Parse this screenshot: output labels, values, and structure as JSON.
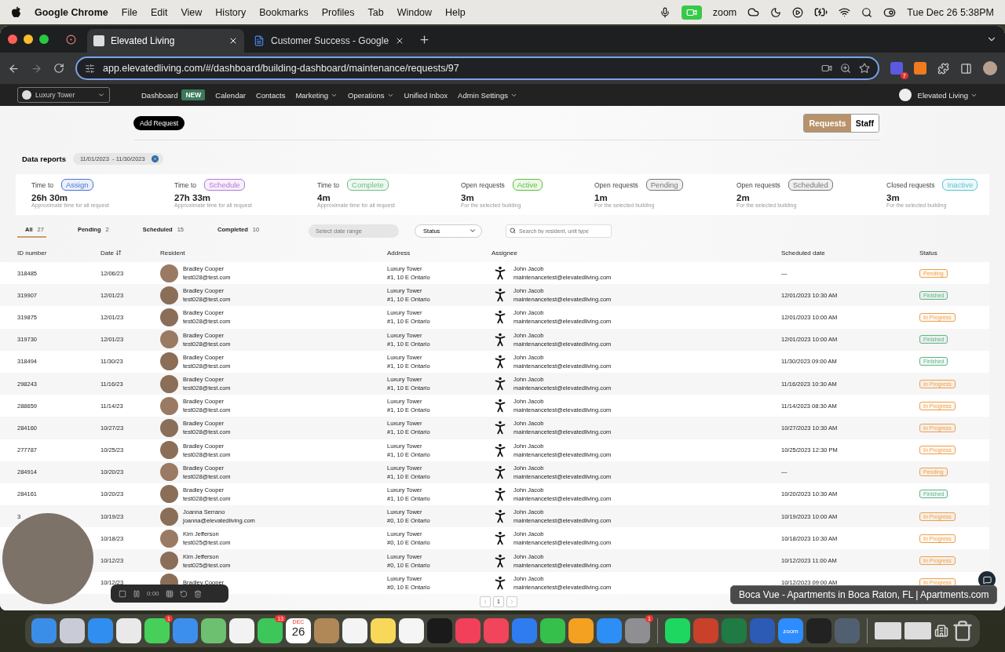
{
  "menubar": {
    "app": "Google Chrome",
    "menus": [
      "File",
      "Edit",
      "View",
      "History",
      "Bookmarks",
      "Profiles",
      "Tab",
      "Window",
      "Help"
    ],
    "zoom_label": "zoom",
    "clock": "Tue Dec 26  5:38PM"
  },
  "browser": {
    "tabs": [
      {
        "title": "Elevated Living",
        "selected": true
      },
      {
        "title": "Customer Success - Google",
        "selected": false
      }
    ],
    "url": "app.elevatedliving.com/#/dashboard/building-dashboard/maintenance/requests/97",
    "extension_badge": "7"
  },
  "nav": {
    "building": "Luxury Tower",
    "items": [
      {
        "label": "Dashboard",
        "badge": "NEW",
        "dropdown": false
      },
      {
        "label": "Calendar",
        "dropdown": false
      },
      {
        "label": "Contacts",
        "dropdown": false
      },
      {
        "label": "Marketing",
        "dropdown": true
      },
      {
        "label": "Operations",
        "dropdown": true
      },
      {
        "label": "Unified Inbox",
        "dropdown": false
      },
      {
        "label": "Admin Settings",
        "dropdown": true
      }
    ],
    "user": "Elevated Living"
  },
  "add_request": "Add Request",
  "view_toggle": [
    {
      "label": "Requests",
      "selected": true
    },
    {
      "label": "Staff",
      "selected": false
    }
  ],
  "reports": {
    "label": "Data reports",
    "date_range": "11/01/2023  - 11/30/2023"
  },
  "stats": [
    {
      "label": "Time to",
      "tag": "Assign",
      "color": "#4a72d6",
      "value": "26h 30m",
      "note": "Approximate time for all request"
    },
    {
      "label": "Time to",
      "tag": "Schedule",
      "color": "#b47ad8",
      "value": "27h 33m",
      "note": "Approximate time for all request"
    },
    {
      "label": "Time to",
      "tag": "Complete",
      "color": "#6cbf86",
      "value": "4m",
      "note": "Approximate time for all request"
    },
    {
      "label": "Open requests",
      "tag": "Active",
      "color": "#5cbf3c",
      "value": "3m",
      "note": "For the selected building"
    },
    {
      "label": "Open requests",
      "tag": "Pending",
      "color": "#777777",
      "value": "1m",
      "note": "For the selected building"
    },
    {
      "label": "Open requests",
      "tag": "Scheduled",
      "color": "#777777",
      "value": "2m",
      "note": "For the selected building"
    },
    {
      "label": "Closed requests",
      "tag": "Inactive",
      "color": "#5ec4d4",
      "value": "3m",
      "note": "For the selected building"
    }
  ],
  "filter_tabs": [
    {
      "label": "All",
      "count": "27",
      "selected": true
    },
    {
      "label": "Pending",
      "count": "2",
      "selected": false
    },
    {
      "label": "Scheduled",
      "count": "15",
      "selected": false
    },
    {
      "label": "Completed",
      "count": "10",
      "selected": false
    }
  ],
  "date_range": {
    "placeholder": "Select date range"
  },
  "status_filter": "Status",
  "search": {
    "placeholder": "Search by resident, unit type"
  },
  "table": {
    "columns": [
      "ID number",
      "Date",
      "Resident",
      "Address",
      "Assignee",
      "Scheduled date",
      "Status"
    ],
    "rows": [
      {
        "id": "318485",
        "date": "12/06/23",
        "resident": "Bradley Cooper",
        "email": "test028@test.com",
        "building": "Luxury Tower",
        "unit": "#1, 10 E Ontario",
        "assignee": "John Jacob",
        "assignee_email": "maintenancetest@elevatedliving.com",
        "scheduled": "—",
        "status": {
          "label": "Pending",
          "color": "#f0a04a"
        }
      },
      {
        "id": "319907",
        "date": "12/01/23",
        "resident": "Bradley Cooper",
        "email": "test028@test.com",
        "building": "Luxury Tower",
        "unit": "#1, 10 E Ontario",
        "assignee": "John Jacob",
        "assignee_email": "maintenancetest@elevatedliving.com",
        "scheduled": "12/01/2023 10:30 AM",
        "status": {
          "label": "Finished",
          "color": "#5fb487"
        }
      },
      {
        "id": "319875",
        "date": "12/01/23",
        "resident": "Bradley Cooper",
        "email": "test028@test.com",
        "building": "Luxury Tower",
        "unit": "#1, 10 E Ontario",
        "assignee": "John Jacob",
        "assignee_email": "maintenancetest@elevatedliving.com",
        "scheduled": "12/01/2023 10:00 AM",
        "status": {
          "label": "In Progress",
          "color": "#f0a04a"
        }
      },
      {
        "id": "319730",
        "date": "12/01/23",
        "resident": "Bradley Cooper",
        "email": "test028@test.com",
        "building": "Luxury Tower",
        "unit": "#1, 10 E Ontario",
        "assignee": "John Jacob",
        "assignee_email": "maintenancetest@elevatedliving.com",
        "scheduled": "12/01/2023 10:00 AM",
        "status": {
          "label": "Finished",
          "color": "#5fb487"
        }
      },
      {
        "id": "318494",
        "date": "11/30/23",
        "resident": "Bradley Cooper",
        "email": "test028@test.com",
        "building": "Luxury Tower",
        "unit": "#1, 10 E Ontario",
        "assignee": "John Jacob",
        "assignee_email": "maintenancetest@elevatedliving.com",
        "scheduled": "11/30/2023 09:00 AM",
        "status": {
          "label": "Finished",
          "color": "#5fb487"
        }
      },
      {
        "id": "298243",
        "date": "11/16/23",
        "resident": "Bradley Cooper",
        "email": "test028@test.com",
        "building": "Luxury Tower",
        "unit": "#1, 10 E Ontario",
        "assignee": "John Jacob",
        "assignee_email": "maintenancetest@elevatedliving.com",
        "scheduled": "11/16/2023 10:30 AM",
        "status": {
          "label": "In Progress",
          "color": "#f0a04a"
        }
      },
      {
        "id": "288659",
        "date": "11/14/23",
        "resident": "Bradley Cooper",
        "email": "test028@test.com",
        "building": "Luxury Tower",
        "unit": "#1, 10 E Ontario",
        "assignee": "John Jacob",
        "assignee_email": "maintenancetest@elevatedliving.com",
        "scheduled": "11/14/2023 08:30 AM",
        "status": {
          "label": "In Progress",
          "color": "#f0a04a"
        }
      },
      {
        "id": "284160",
        "date": "10/27/23",
        "resident": "Bradley Cooper",
        "email": "test028@test.com",
        "building": "Luxury Tower",
        "unit": "#1, 10 E Ontario",
        "assignee": "John Jacob",
        "assignee_email": "maintenancetest@elevatedliving.com",
        "scheduled": "10/27/2023 10:30 AM",
        "status": {
          "label": "In Progress",
          "color": "#f0a04a"
        }
      },
      {
        "id": "277787",
        "date": "10/25/23",
        "resident": "Bradley Cooper",
        "email": "test028@test.com",
        "building": "Luxury Tower",
        "unit": "#1, 10 E Ontario",
        "assignee": "John Jacob",
        "assignee_email": "maintenancetest@elevatedliving.com",
        "scheduled": "10/25/2023 12:30 PM",
        "status": {
          "label": "In Progress",
          "color": "#f0a04a"
        }
      },
      {
        "id": "284914",
        "date": "10/20/23",
        "resident": "Bradley Cooper",
        "email": "test028@test.com",
        "building": "Luxury Tower",
        "unit": "#1, 10 E Ontario",
        "assignee": "John Jacob",
        "assignee_email": "maintenancetest@elevatedliving.com",
        "scheduled": "—",
        "status": {
          "label": "Pending",
          "color": "#f0a04a"
        }
      },
      {
        "id": "284161",
        "date": "10/20/23",
        "resident": "Bradley Cooper",
        "email": "test028@test.com",
        "building": "Luxury Tower",
        "unit": "#1, 10 E Ontario",
        "assignee": "John Jacob",
        "assignee_email": "maintenancetest@elevatedliving.com",
        "scheduled": "10/20/2023 10:30 AM",
        "status": {
          "label": "Finished",
          "color": "#5fb487"
        }
      },
      {
        "id": "3",
        "date": "10/19/23",
        "resident": "Joanna Serrano",
        "email": "joanna@elevatedliving.com",
        "building": "Luxury Tower",
        "unit": "#0, 10 E Ontario",
        "assignee": "John Jacob",
        "assignee_email": "maintenancetest@elevatedliving.com",
        "scheduled": "10/19/2023 10:00 AM",
        "status": {
          "label": "In Progress",
          "color": "#f0a04a"
        }
      },
      {
        "date": "10/18/23",
        "resident": "Kim Jefferson",
        "email": "test025@test.com",
        "building": "Luxury Tower",
        "unit": "#0, 10 E Ontario",
        "assignee": "John Jacob",
        "assignee_email": "maintenancetest@elevatedliving.com",
        "scheduled": "10/18/2023 10:30 AM",
        "status": {
          "label": "In Progress",
          "color": "#f0a04a"
        }
      },
      {
        "date": "10/12/23",
        "resident": "Kim Jefferson",
        "email": "test025@test.com",
        "building": "Luxury Tower",
        "unit": "#0, 10 E Ontario",
        "assignee": "John Jacob",
        "assignee_email": "maintenancetest@elevatedliving.com",
        "scheduled": "10/12/2023 11:00 AM",
        "status": {
          "label": "In Progress",
          "color": "#f0a04a"
        }
      },
      {
        "date": "10/12/23",
        "resident": "Bradley Cooper",
        "building": "Luxury Tower",
        "unit": "#0, 10 E Ontario",
        "assignee": "John Jacob",
        "assignee_email": "maintenancetest@elevatedliving.com",
        "scheduled": "10/12/2023 09:00 AM",
        "status": {
          "label": "In Progress",
          "color": "#f0a04a"
        }
      }
    ]
  },
  "pagination": {
    "page": "1"
  },
  "recorder": {
    "time": "0:00"
  },
  "tooltip": "Boca Vue - Apartments in Boca Raton, FL | Apartments.com",
  "dock": {
    "apps": [
      {
        "kind": "app",
        "color": "#3b8ee8"
      },
      {
        "kind": "app",
        "color": "#c9ccd6"
      },
      {
        "kind": "app",
        "color": "#2f8ef0"
      },
      {
        "kind": "app",
        "color": "#e9e9e9"
      },
      {
        "kind": "app",
        "color": "#46d05a",
        "badge": "1"
      },
      {
        "kind": "app",
        "color": "#3d8fee"
      },
      {
        "kind": "app",
        "color": "#6cc070"
      },
      {
        "kind": "app",
        "color": "#f2f2f2"
      },
      {
        "kind": "app",
        "color": "#3dc75a",
        "badge": "13"
      },
      {
        "kind": "calendar",
        "month": "DEC",
        "day": "26"
      },
      {
        "kind": "app",
        "color": "#b08858"
      },
      {
        "kind": "app",
        "color": "#f4f4f4"
      },
      {
        "kind": "app",
        "color": "#f7d85a"
      },
      {
        "kind": "app",
        "color": "#f5f5f5"
      },
      {
        "kind": "app",
        "color": "#1a1a1a"
      },
      {
        "kind": "app",
        "color": "#f2405a"
      },
      {
        "kind": "app",
        "color": "#f0455a"
      },
      {
        "kind": "app",
        "color": "#2f7cf0"
      },
      {
        "kind": "app",
        "color": "#34c04a"
      },
      {
        "kind": "app",
        "color": "#f4a020"
      },
      {
        "kind": "app",
        "color": "#2d8ef5"
      },
      {
        "kind": "app",
        "color": "#8e8e93",
        "badge": "1"
      }
    ],
    "recent": [
      {
        "kind": "app",
        "color": "#1ed760"
      },
      {
        "kind": "app",
        "color": "#c9412a"
      },
      {
        "kind": "app",
        "color": "#1f7a43"
      },
      {
        "kind": "app",
        "color": "#2b5bb5"
      },
      {
        "kind": "app",
        "color": "#2d8cff",
        "label": "zoom"
      },
      {
        "kind": "app",
        "color": "#222222"
      },
      {
        "kind": "app",
        "color": "#506070"
      }
    ]
  }
}
